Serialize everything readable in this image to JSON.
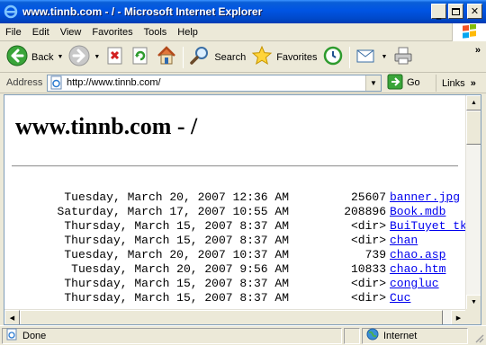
{
  "window": {
    "title": "www.tinnb.com - / - Microsoft Internet Explorer"
  },
  "menu": [
    "File",
    "Edit",
    "View",
    "Favorites",
    "Tools",
    "Help"
  ],
  "toolbar": {
    "back": "Back",
    "search": "Search",
    "favorites": "Favorites"
  },
  "address": {
    "label": "Address",
    "url": "http://www.tinnb.com/",
    "go": "Go",
    "links": "Links"
  },
  "page": {
    "heading": "www.tinnb.com - /",
    "entries": [
      {
        "date": "Tuesday, March 20, 2007 12:36 AM",
        "size": "25607",
        "name": "banner.jpg"
      },
      {
        "date": "Saturday, March 17, 2007 10:55 AM",
        "size": "208896",
        "name": "Book.mdb"
      },
      {
        "date": "Thursday, March 15, 2007 8:37 AM",
        "size": "<dir>",
        "name": "BuiTuyet_tk"
      },
      {
        "date": "Thursday, March 15, 2007 8:37 AM",
        "size": "<dir>",
        "name": "chan"
      },
      {
        "date": "Tuesday, March 20, 2007 10:37 AM",
        "size": "739",
        "name": "chao.asp"
      },
      {
        "date": "Tuesday, March 20, 2007 9:56 AM",
        "size": "10833",
        "name": "chao.htm"
      },
      {
        "date": "Thursday, March 15, 2007 8:37 AM",
        "size": "<dir>",
        "name": "congluc"
      },
      {
        "date": "Thursday, March 15, 2007 8:37 AM",
        "size": "<dir>",
        "name": "Cuc"
      }
    ]
  },
  "status": {
    "text": "Done",
    "zone": "Internet"
  },
  "colors": {
    "titlebar": "#0054e3",
    "link": "#0000ee",
    "chrome": "#ece9d8"
  }
}
